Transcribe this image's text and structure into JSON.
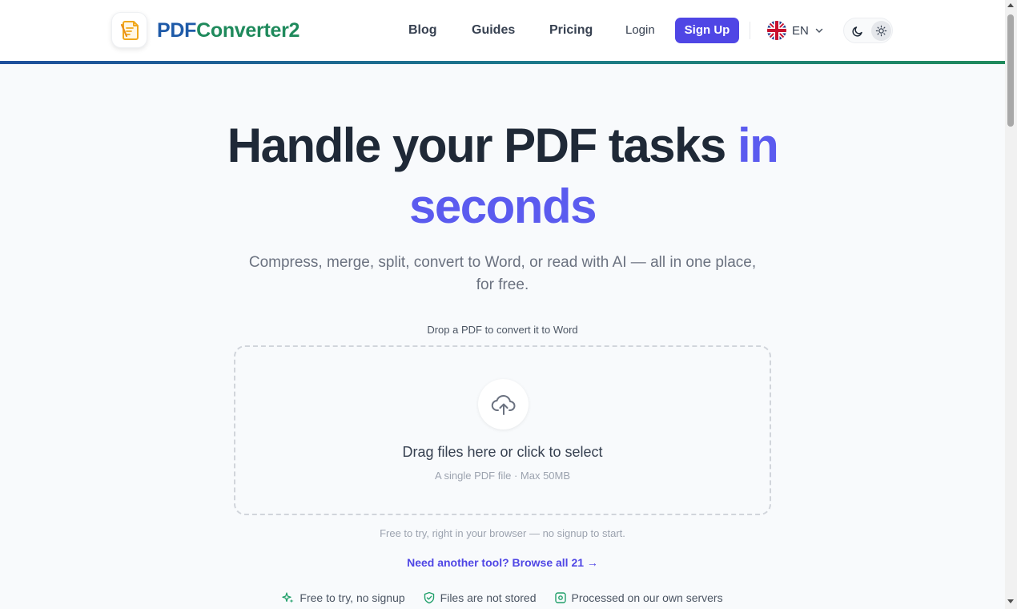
{
  "brand": {
    "part1": "PDF",
    "part2": "Converter2",
    "logo_icon": "document-pencil-icon"
  },
  "nav": {
    "links": [
      "Blog",
      "Guides",
      "Pricing"
    ],
    "login": "Login",
    "signup": "Sign Up",
    "language": "EN",
    "theme_icons": [
      "moon-icon",
      "sun-icon"
    ]
  },
  "hero": {
    "title_main": "Handle your PDF tasks ",
    "title_accent": "in seconds",
    "subtitle": "Compress, merge, split, convert to Word, or read with AI — all in one place, for free."
  },
  "upload": {
    "label": "Drop a PDF to convert it to Word",
    "main_text": "Drag files here or click to select",
    "sub_text": "A single PDF file · Max 50MB",
    "icon": "cloud-upload-icon"
  },
  "notes": {
    "free": "Free to try, right in your browser — no signup to start.",
    "browse": "Need another tool? Browse all 21 →"
  },
  "features": [
    {
      "icon": "sparkle-icon",
      "text": "Free to try, no signup"
    },
    {
      "icon": "shield-check-icon",
      "text": "Files are not stored"
    },
    {
      "icon": "server-icon",
      "text": "Processed on our own servers"
    }
  ],
  "colors": {
    "accent": "#4f46e5",
    "brand_blue": "#1e5aa8",
    "brand_green": "#1f8a5c",
    "feature_green": "#22a06b"
  }
}
